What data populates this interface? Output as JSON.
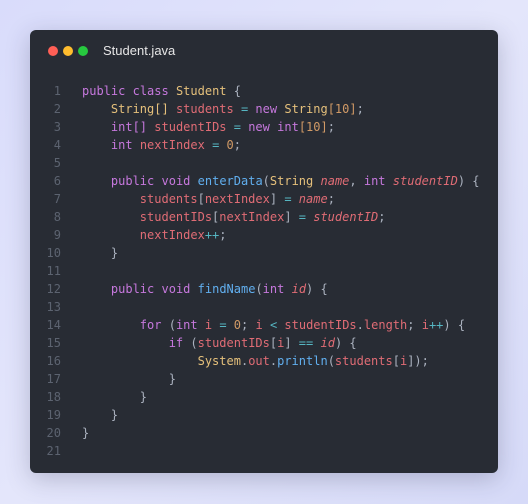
{
  "window": {
    "title": "Student.java"
  },
  "code": {
    "line_numbers": [
      "1",
      "2",
      "3",
      "4",
      "5",
      "6",
      "7",
      "8",
      "9",
      "10",
      "11",
      "12",
      "13",
      "14",
      "15",
      "16",
      "17",
      "18",
      "19",
      "20",
      "21"
    ],
    "tokens": {
      "public": "public",
      "class": "class",
      "Student": "Student",
      "lbrace": "{",
      "rbrace": "}",
      "String_arr": "String[]",
      "students": "students",
      "eq": " = ",
      "new": "new",
      "String": "String",
      "br10": "[10]",
      "semi": ";",
      "int_arr": "int[]",
      "studentIDs": "studentIDs",
      "int": "int",
      "nextIndex": "nextIndex",
      "zero": "0",
      "void": "void",
      "enterData": "enterData",
      "lparen": "(",
      "rparen": ")",
      "name": "name",
      "comma": ", ",
      "studentID": "studentID",
      "lbr": "[",
      "rbr": "]",
      "plusplus": "++",
      "findName": "findName",
      "id": "id",
      "for": "for",
      "i": "i",
      "lt": " < ",
      "dot": ".",
      "length": "length",
      "semi_sp": "; ",
      "if": "if",
      "eqeq": " == ",
      "System": "System",
      "out": "out",
      "println": "println"
    }
  }
}
